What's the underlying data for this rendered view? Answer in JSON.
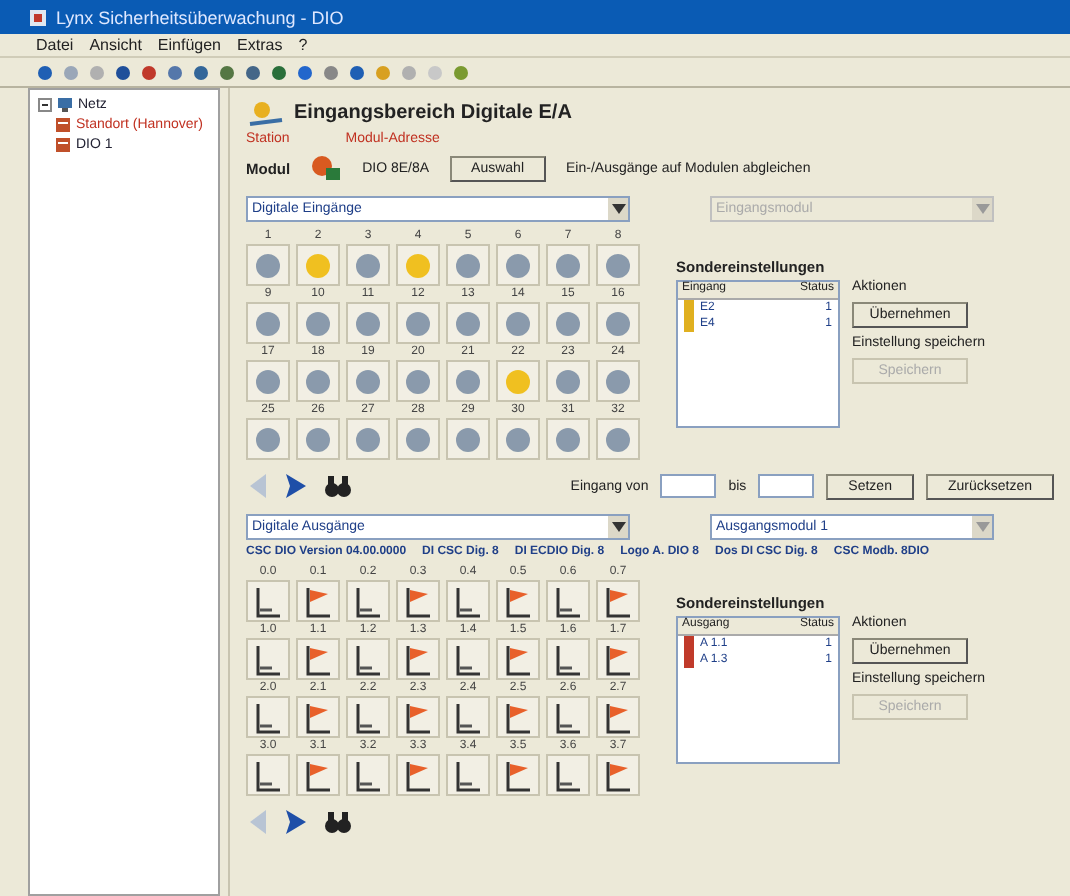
{
  "window": {
    "title": "Lynx Sicherheitsüberwachung - DIO"
  },
  "menu": [
    "Datei",
    "Ansicht",
    "Einfügen",
    "Extras",
    "?"
  ],
  "tree": {
    "label": "Netz",
    "expanded": true,
    "children": [
      {
        "label": "Standort (Hannover)",
        "selected": true
      },
      {
        "label": "DIO 1",
        "selected": false
      }
    ]
  },
  "header": {
    "title": "Eingangsbereich Digitale E/A"
  },
  "device": {
    "caption_1": "Station",
    "caption_2": "Modul-Adresse",
    "label": "Modul",
    "value": "DIO 8E/8A",
    "button": "Auswahl",
    "note": "Ein-/Ausgänge auf Modulen abgleichen"
  },
  "sections": [
    {
      "kind": "led",
      "select": {
        "value": "Digitale Eingänge"
      },
      "select_2": {
        "value": "Eingangsmodul",
        "disabled": true
      },
      "cells": [
        {
          "label": "1",
          "on": false
        },
        {
          "label": "2",
          "on": true
        },
        {
          "label": "3",
          "on": false
        },
        {
          "label": "4",
          "on": true
        },
        {
          "label": "5",
          "on": false
        },
        {
          "label": "6",
          "on": false
        },
        {
          "label": "7",
          "on": false
        },
        {
          "label": "8",
          "on": false
        },
        {
          "label": "9",
          "on": false
        },
        {
          "label": "10",
          "on": false
        },
        {
          "label": "11",
          "on": false
        },
        {
          "label": "12",
          "on": false
        },
        {
          "label": "13",
          "on": false
        },
        {
          "label": "14",
          "on": false
        },
        {
          "label": "15",
          "on": false
        },
        {
          "label": "16",
          "on": false
        },
        {
          "label": "17",
          "on": false
        },
        {
          "label": "18",
          "on": false
        },
        {
          "label": "19",
          "on": false
        },
        {
          "label": "20",
          "on": false
        },
        {
          "label": "21",
          "on": false
        },
        {
          "label": "22",
          "on": true
        },
        {
          "label": "23",
          "on": false
        },
        {
          "label": "24",
          "on": false
        },
        {
          "label": "25",
          "on": false
        },
        {
          "label": "26",
          "on": false
        },
        {
          "label": "27",
          "on": false
        },
        {
          "label": "28",
          "on": false
        },
        {
          "label": "29",
          "on": false
        },
        {
          "label": "30",
          "on": false
        },
        {
          "label": "31",
          "on": false
        },
        {
          "label": "32",
          "on": false
        }
      ],
      "list_title": "Sondereinstellungen",
      "columns": [
        "Eingang",
        "Status"
      ],
      "rows": [
        {
          "name": "E2",
          "status": "1"
        },
        {
          "name": "E4",
          "status": "1"
        }
      ],
      "side_label": "Aktionen",
      "side_button": {
        "label": "Übernehmen",
        "disabled": false
      },
      "side_label_2": "Einstellung speichern",
      "side_button_2": {
        "label": "Speichern",
        "disabled": true
      },
      "nav": {
        "from_label": "Eingang von",
        "to_label": "bis",
        "button_1": "Setzen",
        "button_2": "Zurücksetzen"
      }
    },
    {
      "kind": "flag",
      "select": {
        "value": "Digitale Ausgänge"
      },
      "select_2": {
        "value": "Ausgangsmodul 1",
        "disabled": false
      },
      "info": [
        "CSC DIO Version 04.00.0000",
        "DI CSC Dig. 8",
        "DI ECDIO Dig. 8",
        "Logo A. DIO 8",
        "Dos DI CSC Dig. 8",
        "CSC Modb. 8DIO"
      ],
      "cells": [
        {
          "label": "0.0",
          "on": false
        },
        {
          "label": "0.1",
          "on": true
        },
        {
          "label": "0.2",
          "on": false
        },
        {
          "label": "0.3",
          "on": true
        },
        {
          "label": "0.4",
          "on": false
        },
        {
          "label": "0.5",
          "on": true
        },
        {
          "label": "0.6",
          "on": false
        },
        {
          "label": "0.7",
          "on": true
        },
        {
          "label": "1.0",
          "on": false
        },
        {
          "label": "1.1",
          "on": true
        },
        {
          "label": "1.2",
          "on": false
        },
        {
          "label": "1.3",
          "on": true
        },
        {
          "label": "1.4",
          "on": false
        },
        {
          "label": "1.5",
          "on": true
        },
        {
          "label": "1.6",
          "on": false
        },
        {
          "label": "1.7",
          "on": true
        },
        {
          "label": "2.0",
          "on": false
        },
        {
          "label": "2.1",
          "on": true
        },
        {
          "label": "2.2",
          "on": false
        },
        {
          "label": "2.3",
          "on": true
        },
        {
          "label": "2.4",
          "on": false
        },
        {
          "label": "2.5",
          "on": true
        },
        {
          "label": "2.6",
          "on": false
        },
        {
          "label": "2.7",
          "on": true
        },
        {
          "label": "3.0",
          "on": false
        },
        {
          "label": "3.1",
          "on": true
        },
        {
          "label": "3.2",
          "on": false
        },
        {
          "label": "3.3",
          "on": true
        },
        {
          "label": "3.4",
          "on": false
        },
        {
          "label": "3.5",
          "on": true
        },
        {
          "label": "3.6",
          "on": false
        },
        {
          "label": "3.7",
          "on": true
        }
      ],
      "list_title": "Sondereinstellungen",
      "columns": [
        "Ausgang",
        "Status"
      ],
      "rows": [
        {
          "name": "A 1.1",
          "status": "1"
        },
        {
          "name": "A 1.3",
          "status": "1"
        }
      ],
      "side_label": "Aktionen",
      "side_button": {
        "label": "Übernehmen",
        "disabled": false
      },
      "side_label_2": "Einstellung speichern",
      "side_button_2": {
        "label": "Speichern",
        "disabled": true
      }
    }
  ]
}
